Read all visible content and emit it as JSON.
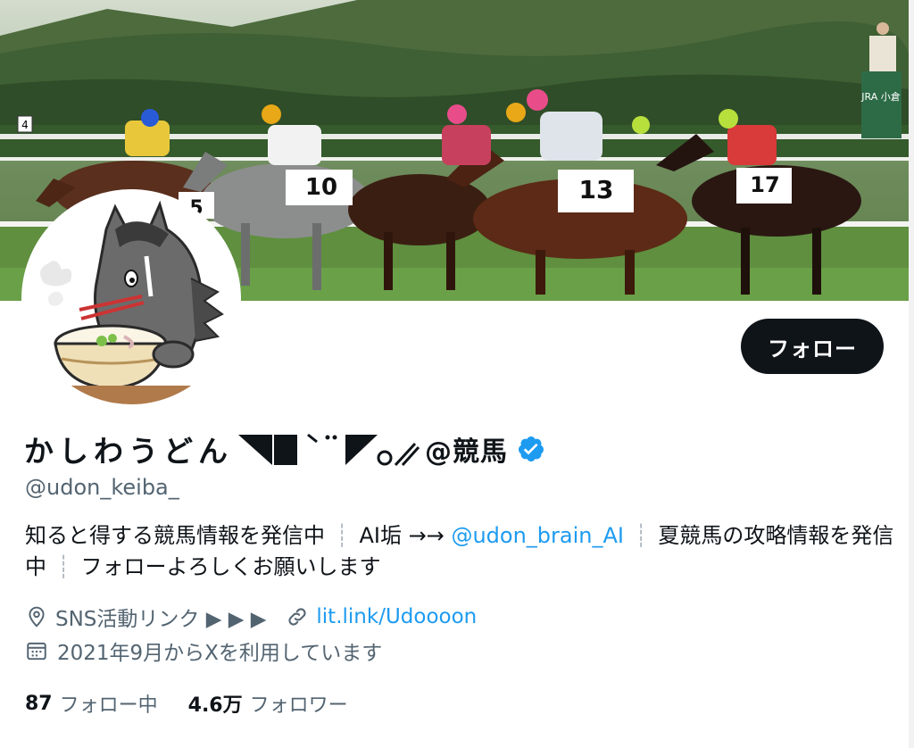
{
  "profile": {
    "display_name": "かしわうどん",
    "name_suffix": "@競馬",
    "handle": "@udon_keiba_",
    "follow_button": "フォロー",
    "verified_icon": "verified-badge-icon",
    "bio": {
      "part1": "知ると得する競馬情報を発信中",
      "sep1": "┊",
      "part2": "AI垢 →→",
      "mention": "@udon_brain_AI",
      "sep2": "┊",
      "part3": "夏競馬の攻略情報を発信中",
      "sep3": "┊",
      "part4": "フォローよろしくお願いします"
    },
    "location": "SNS活動リンク ▶ ▶ ▶",
    "website": "lit.link/Udoooon",
    "joined": "2021年9月からXを利用しています",
    "following_count": "87",
    "following_label": "フォロー中",
    "followers_count": "4.6万",
    "followers_label": "フォロワー"
  },
  "banner": {
    "saddle_numbers": [
      "5",
      "10",
      "13",
      "17"
    ],
    "sign_text": "JRA 小倉",
    "pole_number": "4"
  },
  "colors": {
    "accent": "#1d9bf0",
    "text": "#0f1419",
    "muted": "#536471",
    "button_bg": "#0f1419"
  }
}
